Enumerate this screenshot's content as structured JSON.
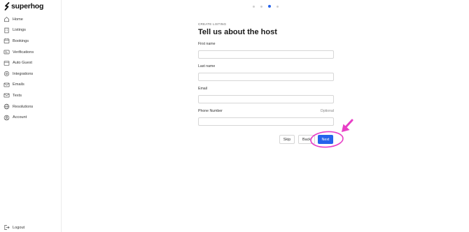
{
  "brand": {
    "name": "superhog"
  },
  "sidebar": {
    "items": [
      {
        "label": "Home",
        "icon": "home-icon"
      },
      {
        "label": "Listings",
        "icon": "building-icon"
      },
      {
        "label": "Bookings",
        "icon": "calendar-icon"
      },
      {
        "label": "Verifications",
        "icon": "id-card-icon"
      },
      {
        "label": "Auto Guest",
        "icon": "auto-guest-icon"
      },
      {
        "label": "Integrations",
        "icon": "gear-icon"
      },
      {
        "label": "Emails",
        "icon": "envelope-icon"
      },
      {
        "label": "Texts",
        "icon": "message-icon"
      },
      {
        "label": "Resolutions",
        "icon": "globe-icon"
      },
      {
        "label": "Account",
        "icon": "user-circle-icon"
      }
    ],
    "logout_label": "Logout"
  },
  "stepper": {
    "total": 4,
    "current": 3
  },
  "form": {
    "eyebrow": "CREATE LISTING",
    "title": "Tell us about the host",
    "fields": [
      {
        "label": "First name",
        "value": "",
        "optional": ""
      },
      {
        "label": "Last name",
        "value": "",
        "optional": ""
      },
      {
        "label": "Email",
        "value": "",
        "optional": ""
      },
      {
        "label": "Phone Number",
        "value": "",
        "optional": "Optional"
      }
    ]
  },
  "actions": {
    "skip": "Skip",
    "back": "Back",
    "next": "Next"
  },
  "colors": {
    "primary": "#2563eb",
    "annotation": "#e83fc6"
  }
}
